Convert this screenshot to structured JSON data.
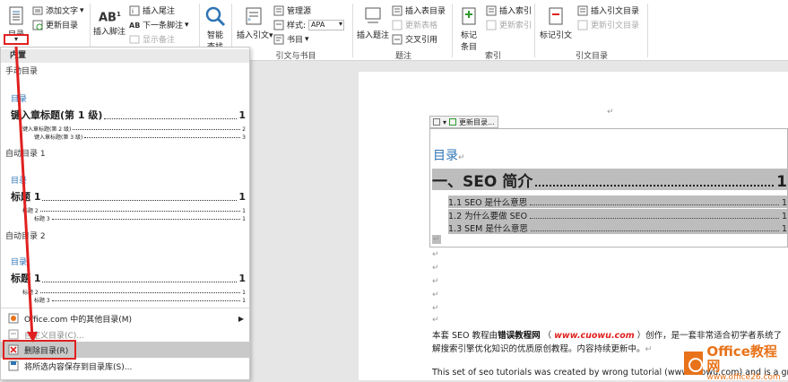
{
  "ribbon": {
    "toc_label": "目录",
    "add_text": "添加文字",
    "update_toc": "更新目录",
    "insert_footnote": "插入脚注",
    "insert_endnote": "插入尾注",
    "next_footnote": "下一条脚注",
    "show_notes": "显示备注",
    "smart_lookup_1": "智能",
    "smart_lookup_2": "查找",
    "insert_citation": "插入引文",
    "manage_sources": "管理源",
    "style_label": "样式:",
    "style_value": "APA",
    "bibliography": "书目",
    "insert_caption": "插入题注",
    "insert_table_of_figures": "插入表目录",
    "update_table": "更新表格",
    "cross_reference": "交叉引用",
    "mark_entry_1": "标记",
    "mark_entry_2": "条目",
    "insert_index": "插入索引",
    "update_index": "更新索引",
    "mark_citation": "标记引文",
    "insert_table_of_authorities": "插入引文目录",
    "update_table_of_authorities": "更新引文目录",
    "groups": {
      "citations": "引文与书目",
      "captions": "题注",
      "index": "索引",
      "authorities": "引文目录"
    }
  },
  "dropdown": {
    "builtin_header": "内置",
    "manual_name": "手动目录",
    "manual_title": "目录",
    "manual_l1": "键入章标题(第 1 级)",
    "manual_l1_page": "1",
    "manual_l2": "键入章标题(第 2 级)",
    "manual_l2_page": "2",
    "manual_l3": "键入章标题(第 3 级)",
    "manual_l3_page": "3",
    "auto1_name": "自动目录 1",
    "auto1_title": "目录",
    "auto1_l1": "标题 1",
    "auto1_l2": "标题 2",
    "auto1_l3": "标题 3",
    "auto2_name": "自动目录 2",
    "auto2_title": "目录",
    "auto2_l1": "标题 1",
    "auto2_l2": "标题 2",
    "auto2_l3": "标题 3",
    "page_one": "1",
    "more_toc": "Office.com 中的其他目录(M)",
    "custom_toc": "自定义目录(C)...",
    "remove_toc": "删除目录(R)",
    "save_selection": "将所选内容保存到目录库(S)..."
  },
  "document": {
    "update_toc_tab": "更新目录...",
    "toc_title": "目录",
    "h1": "一、SEO 简介",
    "h1_page": "1",
    "items": [
      {
        "text": "1.1 SEO 是什么意思",
        "page": "1"
      },
      {
        "text": "1.2  为什么要做 SEO",
        "page": "1"
      },
      {
        "text": "1.3 SEM 是什么意思",
        "page": "1"
      }
    ],
    "para1_a": "本套 SEO 教程由",
    "para1_b": "错误教程网",
    "para1_c": "（",
    "para1_d": "www.cuowu.com",
    "para1_e": "）创作，是一套非常适合初学者系统了",
    "para2": "解搜索引擎优化知识的优质原创教程。内容持续更新中。",
    "para3": "This set of seo tutorials was created by wrong tutorial (www.cuowu.com) and is a great",
    "return_mark": "↵"
  },
  "watermark": {
    "line1": "Office教程网",
    "line2": "www.office26.com"
  },
  "colors": {
    "accent_blue": "#2e74b5",
    "annotation_red": "#e02020",
    "highlight_gray": "#bdbdbd",
    "brand_orange": "#e8731a"
  }
}
